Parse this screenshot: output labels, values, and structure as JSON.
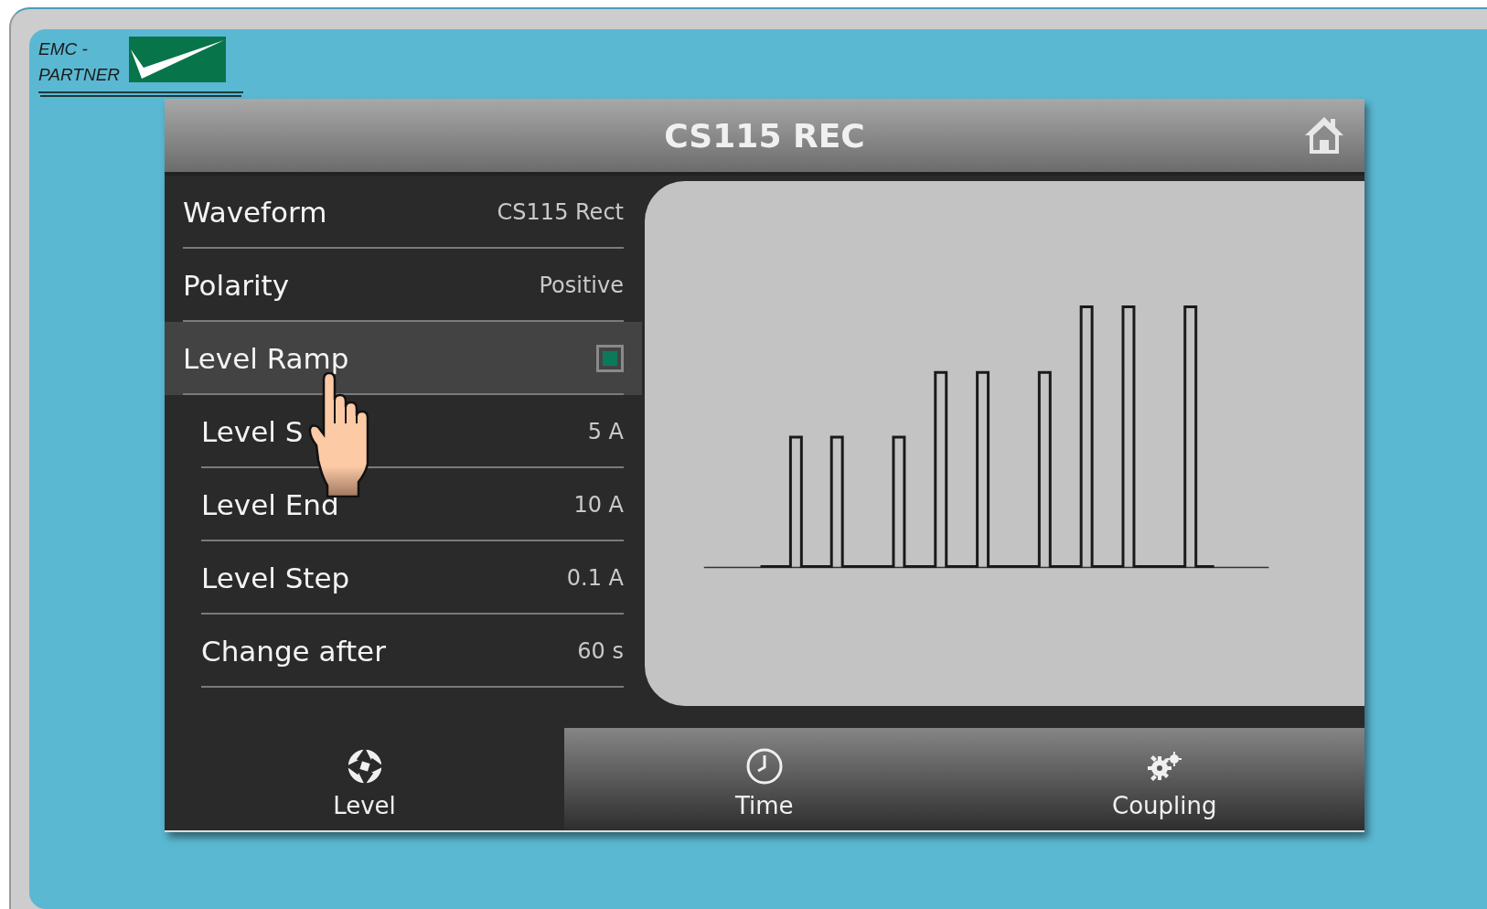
{
  "logo": {
    "lines": [
      "EMC -",
      "PARTNER"
    ]
  },
  "header": {
    "title": "CS115 REC"
  },
  "settings": [
    {
      "kind": "value",
      "label": "Waveform",
      "value": "CS115 Rect",
      "selected": false
    },
    {
      "kind": "value",
      "label": "Polarity",
      "value": "Positive",
      "selected": false
    },
    {
      "kind": "checkbox",
      "label": "Level Ramp",
      "checked": true,
      "selected": true,
      "children": [
        {
          "kind": "value",
          "label": "Level S",
          "value": "5 A",
          "selected": false
        },
        {
          "kind": "value",
          "label": "Level End",
          "value": "10 A",
          "selected": false
        },
        {
          "kind": "value",
          "label": "Level Step",
          "value": "0.1 A",
          "selected": false
        },
        {
          "kind": "value",
          "label": "Change after",
          "value": "60 s",
          "selected": false
        }
      ]
    }
  ],
  "tabs": [
    {
      "label": "Level",
      "kind": "level",
      "selected": true
    },
    {
      "label": "Time",
      "kind": "time",
      "selected": false
    },
    {
      "label": "Coupling",
      "kind": "coupling",
      "selected": false
    }
  ]
}
